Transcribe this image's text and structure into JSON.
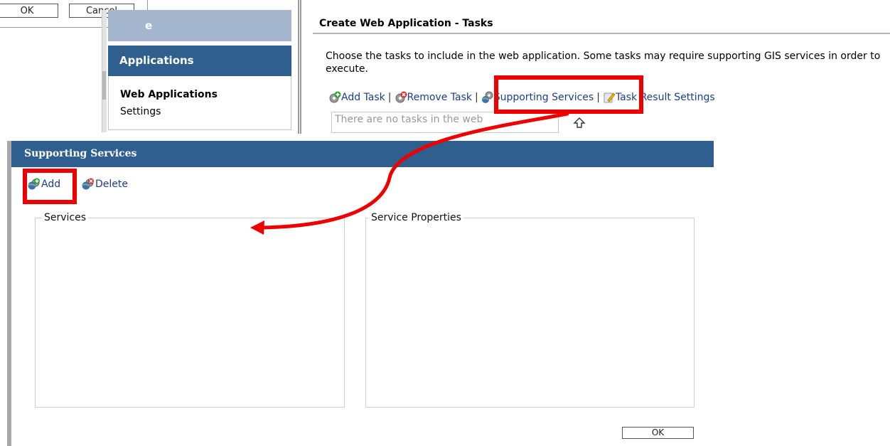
{
  "top_dialog": {
    "ok_label": "OK",
    "cancel_label": "Cancel"
  },
  "nav": {
    "home_label": "e",
    "applications_label": "Applications",
    "sub_items": [
      "Web Applications",
      "Settings"
    ]
  },
  "main": {
    "title": "Create Web Application - Tasks",
    "instructions": "Choose the tasks to include in the web application. Some tasks may require supporting GIS services in order to execute.",
    "toolbar": {
      "add_task": "Add Task",
      "remove_task": "Remove Task",
      "supporting_services": "Supporting Services",
      "task_result_settings": "Task Result Settings",
      "separator": "|"
    },
    "task_list_text": "There are no tasks in the web"
  },
  "supporting_services_panel": {
    "title": "Supporting Services",
    "add_label": "Add",
    "delete_label": "Delete",
    "services_legend": "Services",
    "properties_legend": "Service Properties",
    "ok_label": "OK"
  },
  "annotations": {
    "highlight_color": "#ee0000",
    "highlighted": [
      "Supporting Services",
      "Add"
    ],
    "arrow": "from supporting-services highlight to services box"
  },
  "colors": {
    "nav_active": "#2f5f8f",
    "nav_inactive": "#a3b6cd",
    "panel_header": "#2f5f8f",
    "link": "#1a3f8a"
  },
  "icons": {
    "add_task": "gear-add-icon",
    "remove_task": "gear-remove-icon",
    "supporting_services": "globe-gear-icon",
    "task_result_settings": "pencil-icon",
    "add_service": "globe-add-icon",
    "delete_service": "globe-delete-icon",
    "move_up": "up-arrow-icon"
  }
}
